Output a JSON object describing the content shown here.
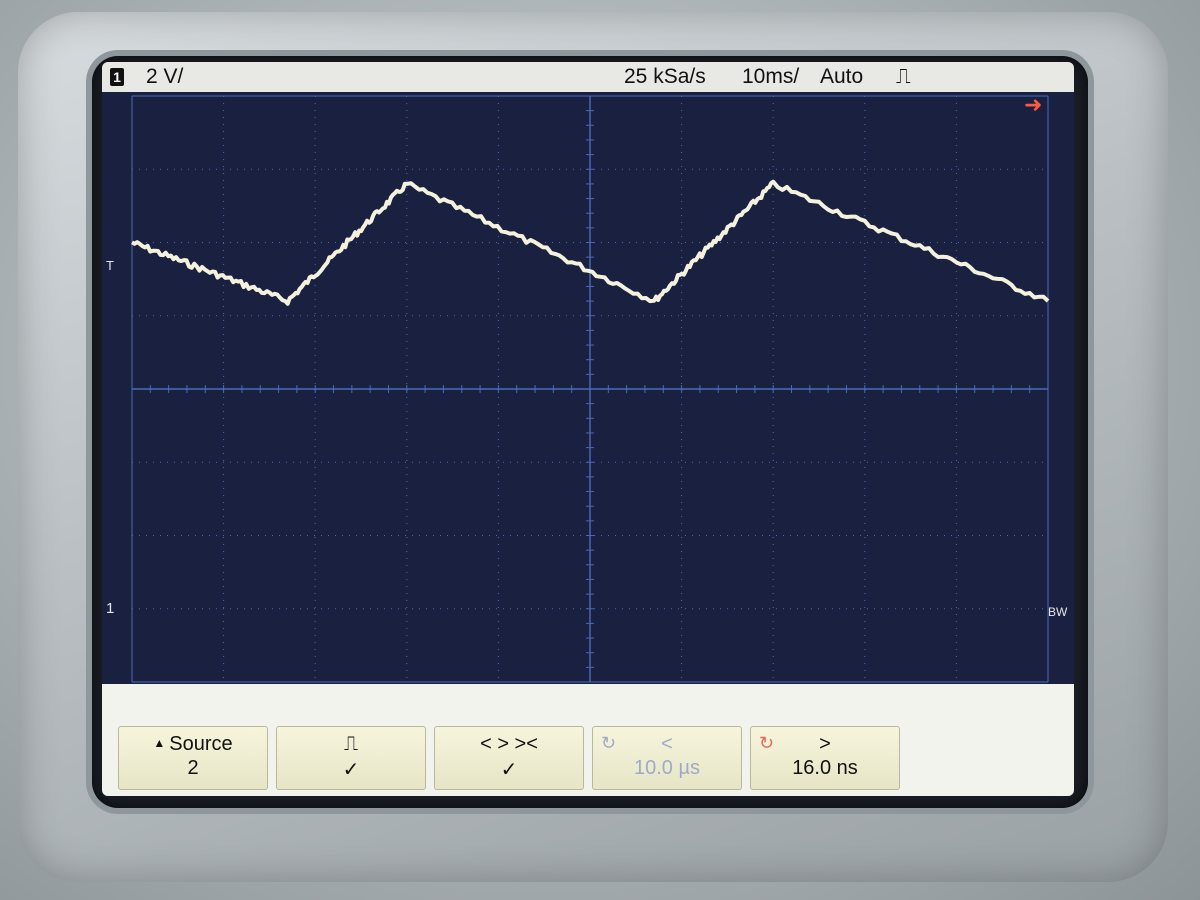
{
  "status": {
    "channel_number": "1",
    "volts_per_div": "2 V/",
    "sample_rate": "25 kSa/s",
    "time_per_div": "10ms/",
    "trigger_mode": "Auto",
    "trigger_type_icon": "rising-edge-pulse-icon"
  },
  "markers": {
    "trigger_position_icon": "right-arrow-icon",
    "channel_ground_label": "1",
    "trigger_level_label": "T",
    "bw_label": "BW"
  },
  "softkeys": [
    {
      "line1": "Source",
      "line2": "2",
      "icon": "up-triangle-icon"
    },
    {
      "line1": "⎍",
      "line2": "✓",
      "icon": "pulse-icon"
    },
    {
      "line1": "< >  ><",
      "line2": "✓",
      "icon": "qualifier-icon"
    },
    {
      "line1": "<",
      "line2": "10.0 µs",
      "icon": "knob-icon"
    },
    {
      "line1": ">",
      "line2": "16.0 ns",
      "icon": "knob-icon"
    }
  ],
  "colors": {
    "screen_bg": "#1a2040",
    "grid": "#4a6ab8",
    "trace": "#f4f1dc",
    "softkey_bg": "#f6f5dc",
    "trigger_marker": "#ff5a3c"
  },
  "chart_data": {
    "type": "line",
    "xlim": [
      0,
      100
    ],
    "ylim": [
      -8,
      8
    ],
    "x": [
      0,
      17,
      30,
      57,
      70,
      100
    ],
    "series": [
      {
        "values": [
          4.0,
          2.4,
          5.6,
          2.4,
          5.6,
          2.4
        ]
      }
    ]
  }
}
